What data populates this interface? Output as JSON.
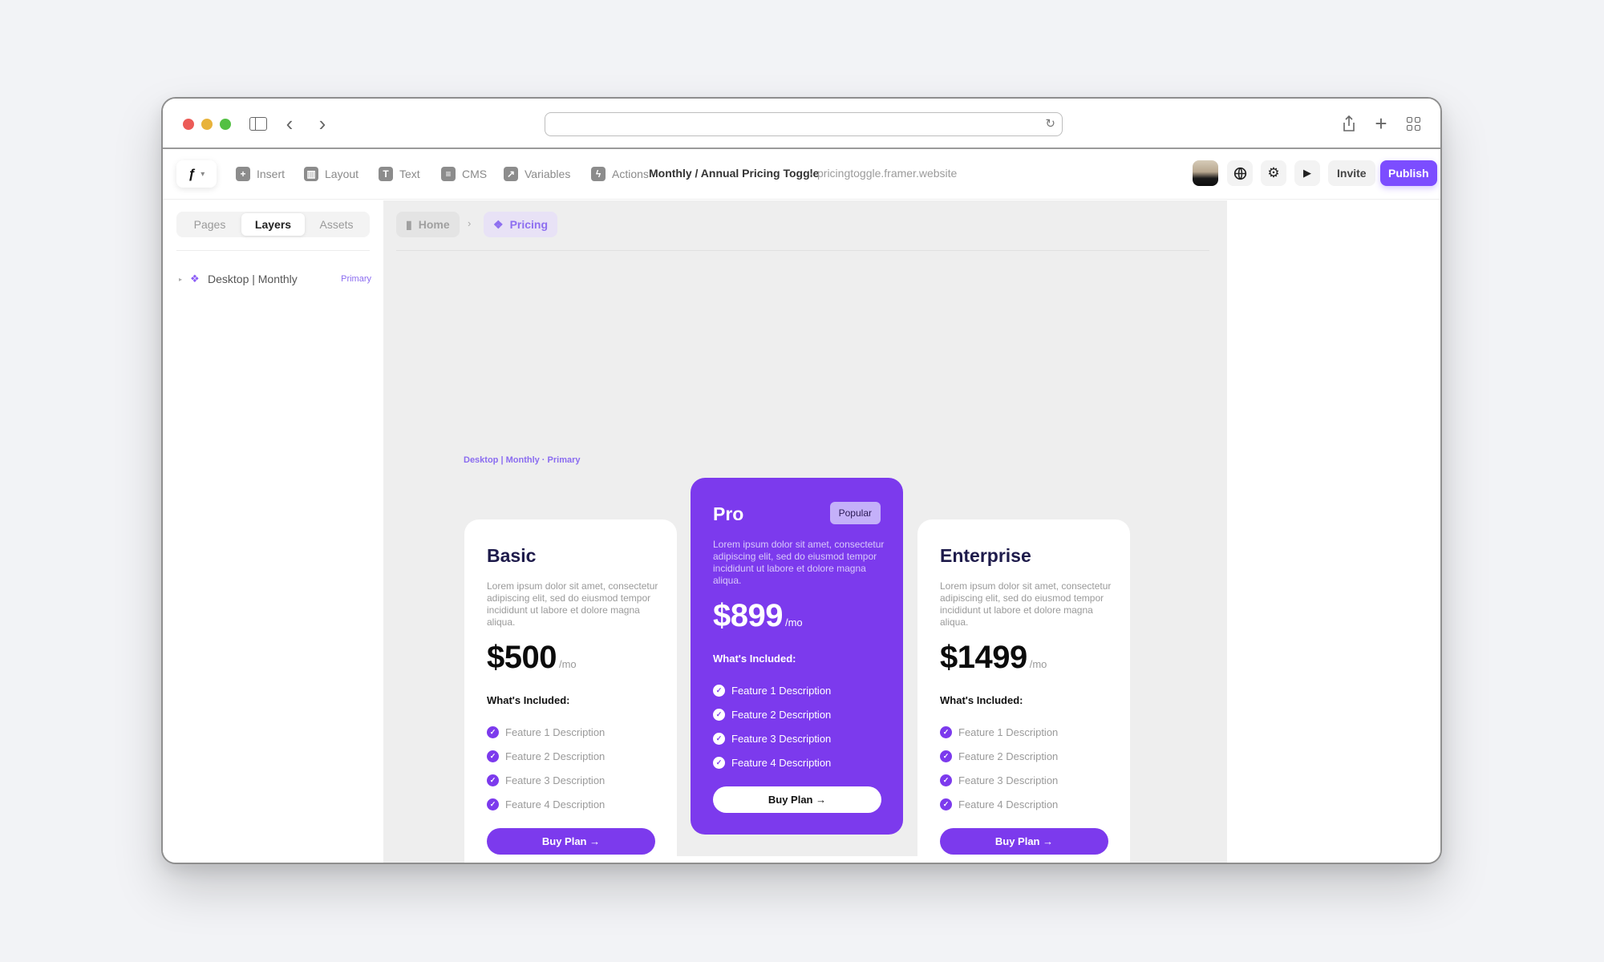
{
  "browser": {
    "url": "",
    "icons": [
      "sidebar-toggle-icon",
      "back-icon",
      "forward-icon",
      "reload-icon",
      "share-icon",
      "new-tab-icon",
      "tab-overview-icon"
    ]
  },
  "toolbar": {
    "tools": [
      {
        "label": "Insert",
        "icon": "+"
      },
      {
        "label": "Layout",
        "icon": "▥"
      },
      {
        "label": "Text",
        "icon": "T"
      },
      {
        "label": "CMS",
        "icon": "≡"
      },
      {
        "label": "Variables",
        "icon": "↗"
      },
      {
        "label": "Actions",
        "icon": "ϟ"
      }
    ],
    "project_title": "Monthly / Annual Pricing Toggle",
    "separator": "·",
    "project_url": "pricingtoggle.framer.website",
    "invite_label": "Invite",
    "publish_label": "Publish",
    "accent_color": "#7c4dff"
  },
  "left_panel": {
    "tabs": [
      {
        "label": "Pages",
        "active": false
      },
      {
        "label": "Layers",
        "active": true
      },
      {
        "label": "Assets",
        "active": false
      }
    ],
    "layers": [
      {
        "name": "Desktop | Monthly",
        "tag": "Primary"
      }
    ]
  },
  "canvas": {
    "breadcrumb": [
      {
        "label": "Home",
        "icon": "page-icon"
      },
      {
        "label": "Pricing",
        "icon": "component-icon"
      }
    ],
    "frame_label": "Desktop | Monthly · Primary",
    "plans": [
      {
        "name": "Basic",
        "description": "Lorem ipsum dolor sit amet, consectetur adipiscing elit, sed do eiusmod tempor incididunt ut labore et dolore magna aliqua.",
        "price": "$500",
        "period": "/mo",
        "included_label": "What's Included:",
        "features": [
          "Feature 1 Description",
          "Feature 2 Description",
          "Feature 3 Description",
          "Feature 4 Description"
        ],
        "cta": "Buy Plan →"
      },
      {
        "name": "Pro",
        "badge": "Popular",
        "description": "Lorem ipsum dolor sit amet, consectetur adipiscing elit, sed do eiusmod tempor incididunt ut labore et dolore magna aliqua.",
        "price": "$899",
        "period": "/mo",
        "included_label": "What's Included:",
        "features": [
          "Feature 1 Description",
          "Feature 2 Description",
          "Feature 3 Description",
          "Feature 4 Description"
        ],
        "cta": "Buy Plan →"
      },
      {
        "name": "Enterprise",
        "description": "Lorem ipsum dolor sit amet, consectetur adipiscing elit, sed do eiusmod tempor incididunt ut labore et dolore magna aliqua.",
        "price": "$1499",
        "period": "/mo",
        "included_label": "What's Included:",
        "features": [
          "Feature 1 Description",
          "Feature 2 Description",
          "Feature 3 Description",
          "Feature 4 Description"
        ],
        "cta": "Buy Plan →"
      }
    ],
    "plan_accent": "#7c3aed"
  }
}
